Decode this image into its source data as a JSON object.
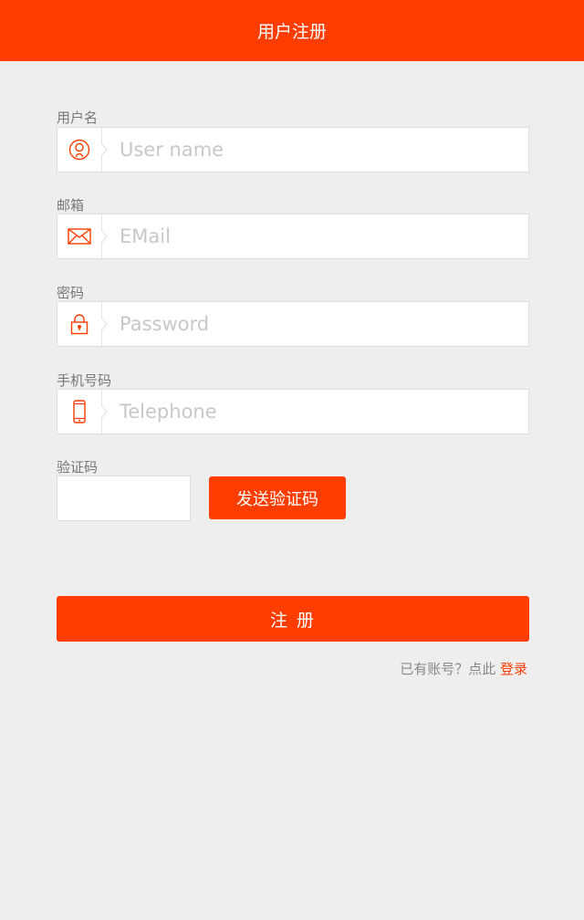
{
  "header": {
    "title": "用户注册"
  },
  "fields": {
    "username": {
      "label": "用户名",
      "placeholder": "User name",
      "icon": "user-icon"
    },
    "email": {
      "label": "邮箱",
      "placeholder": "EMail",
      "icon": "mail-icon"
    },
    "password": {
      "label": "密码",
      "placeholder": "Password",
      "icon": "lock-icon"
    },
    "phone": {
      "label": "手机号码",
      "placeholder": "Telephone",
      "icon": "phone-icon"
    },
    "code": {
      "label": "验证码",
      "placeholder": ""
    }
  },
  "buttons": {
    "send_code": "发送验证码",
    "register": "注 册"
  },
  "footer": {
    "prompt": "已有账号？点此",
    "login_link": "登录"
  },
  "colors": {
    "accent": "#ff3d00",
    "background": "#eeeeee",
    "label": "#777777",
    "placeholder": "#c8c8c8"
  }
}
